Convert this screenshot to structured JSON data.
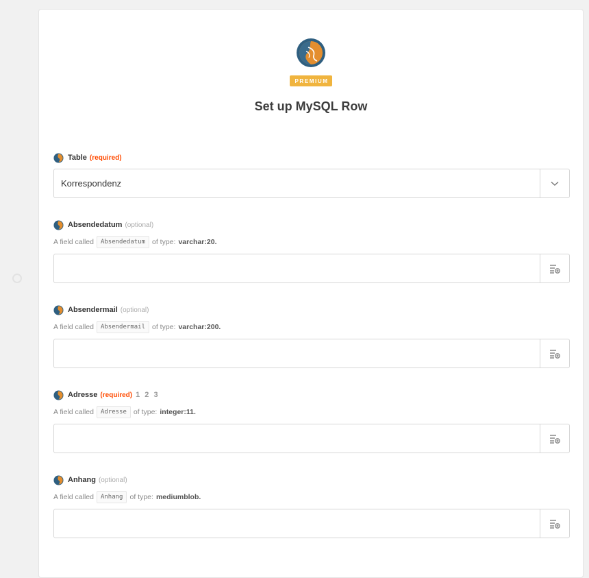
{
  "header": {
    "badge": "PREMIUM",
    "title": "Set up MySQL Row"
  },
  "fields": [
    {
      "label": "Table",
      "tag": "(required)",
      "value": "Korrespondenz"
    },
    {
      "label": "Absendedatum",
      "tag": "(optional)",
      "help_prefix": "A field called",
      "code": "Absendedatum",
      "help_mid": "of type:",
      "type": "varchar:20."
    },
    {
      "label": "Absendermail",
      "tag": "(optional)",
      "help_prefix": "A field called",
      "code": "Absendermail",
      "help_mid": "of type:",
      "type": "varchar:200."
    },
    {
      "label": "Adresse",
      "tag": "(required)",
      "extra": "1 2 3",
      "help_prefix": "A field called",
      "code": "Adresse",
      "help_mid": "of type:",
      "type": "integer:11."
    },
    {
      "label": "Anhang",
      "tag": "(optional)",
      "help_prefix": "A field called",
      "code": "Anhang",
      "help_mid": "of type:",
      "type": "mediumblob."
    }
  ],
  "colors": {
    "required": "#ff4a00",
    "badge": "#f0b43e",
    "logo_blue": "#3a6b8c",
    "logo_orange": "#e48e2e"
  },
  "icons": {
    "field_icon": "mysql-logo-icon",
    "dropdown": "chevron-down-icon",
    "insert": "insert-data-icon"
  }
}
